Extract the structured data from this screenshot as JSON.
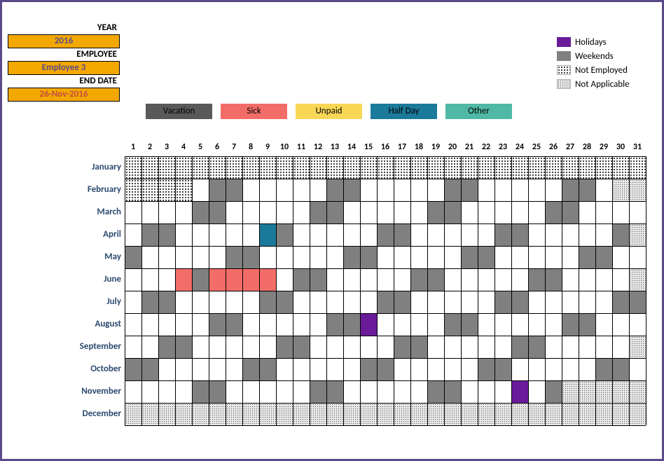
{
  "header": {
    "year_label": "YEAR",
    "year_value": "2016",
    "employee_label": "EMPLOYEE",
    "employee_value": "Employee 3",
    "enddate_label": "END DATE",
    "enddate_value": "26-Nov-2016"
  },
  "legend_right": {
    "holidays": "Holidays",
    "weekends": "Weekends",
    "notemployed": "Not Employed",
    "notapplicable": "Not Applicable"
  },
  "categories": {
    "vacation": "Vacation",
    "sick": "Sick",
    "unpaid": "Unpaid",
    "halfday": "Half Day",
    "other": "Other"
  },
  "days": [
    "1",
    "2",
    "3",
    "4",
    "5",
    "6",
    "7",
    "8",
    "9",
    "10",
    "11",
    "12",
    "13",
    "14",
    "15",
    "16",
    "17",
    "18",
    "19",
    "20",
    "21",
    "22",
    "23",
    "24",
    "25",
    "26",
    "27",
    "28",
    "29",
    "30",
    "31"
  ],
  "months": [
    {
      "name": "January",
      "cells": [
        "notemployed",
        "notemployed",
        "notemployed",
        "notemployed",
        "notemployed",
        "notemployed",
        "notemployed",
        "notemployed",
        "notemployed",
        "notemployed",
        "notemployed",
        "notemployed",
        "notemployed",
        "notemployed",
        "notemployed",
        "notemployed",
        "notemployed",
        "notemployed",
        "notemployed",
        "notemployed",
        "notemployed",
        "notemployed",
        "notemployed",
        "notemployed",
        "notemployed",
        "notemployed",
        "notemployed",
        "notemployed",
        "notemployed",
        "notemployed",
        "notemployed"
      ]
    },
    {
      "name": "February",
      "cells": [
        "notemployed",
        "notemployed",
        "notemployed",
        "notemployed",
        "",
        "weekend",
        "weekend",
        "",
        "",
        "",
        "",
        "",
        "weekend",
        "weekend",
        "",
        "",
        "",
        "",
        "",
        "weekend",
        "weekend",
        "",
        "",
        "",
        "",
        "",
        "weekend",
        "weekend",
        "",
        "notapplicable",
        "notapplicable"
      ]
    },
    {
      "name": "March",
      "cells": [
        "",
        "",
        "",
        "",
        "weekend",
        "weekend",
        "",
        "",
        "",
        "",
        "",
        "weekend",
        "weekend",
        "",
        "",
        "",
        "",
        "",
        "weekend",
        "weekend",
        "",
        "",
        "",
        "",
        "",
        "weekend",
        "weekend",
        "",
        "",
        "",
        "",
        ""
      ]
    },
    {
      "name": "April",
      "cells": [
        "",
        "weekend",
        "weekend",
        "",
        "",
        "",
        "",
        "",
        "halfday",
        "weekend",
        "",
        "",
        "",
        "",
        "",
        "weekend",
        "weekend",
        "",
        "",
        "",
        "",
        "",
        "weekend",
        "weekend",
        "",
        "",
        "",
        "",
        "",
        "weekend",
        "notapplicable"
      ]
    },
    {
      "name": "May",
      "cells": [
        "weekend",
        "",
        "",
        "",
        "",
        "",
        "weekend",
        "weekend",
        "",
        "",
        "",
        "",
        "",
        "weekend",
        "weekend",
        "",
        "",
        "",
        "",
        "",
        "weekend",
        "weekend",
        "",
        "",
        "",
        "",
        "",
        "weekend",
        "weekend",
        "",
        ""
      ]
    },
    {
      "name": "June",
      "cells": [
        "",
        "",
        "",
        "sick",
        "weekend",
        "sick",
        "sick",
        "sick",
        "sick",
        "",
        "weekend",
        "weekend",
        "",
        "",
        "",
        "",
        "",
        "weekend",
        "weekend",
        "",
        "",
        "",
        "",
        "",
        "weekend",
        "weekend",
        "",
        "",
        "",
        "",
        "notapplicable"
      ]
    },
    {
      "name": "July",
      "cells": [
        "",
        "weekend",
        "weekend",
        "",
        "",
        "",
        "",
        "",
        "weekend",
        "weekend",
        "",
        "",
        "",
        "",
        "",
        "weekend",
        "weekend",
        "",
        "",
        "",
        "",
        "",
        "weekend",
        "weekend",
        "",
        "",
        "",
        "",
        "",
        "weekend",
        "weekend"
      ]
    },
    {
      "name": "August",
      "cells": [
        "",
        "",
        "",
        "",
        "",
        "weekend",
        "weekend",
        "",
        "",
        "",
        "",
        "",
        "weekend",
        "weekend",
        "holiday",
        "",
        "",
        "",
        "",
        "weekend",
        "weekend",
        "",
        "",
        "",
        "",
        "",
        "weekend",
        "weekend",
        "",
        "",
        ""
      ]
    },
    {
      "name": "September",
      "cells": [
        "",
        "",
        "weekend",
        "weekend",
        "",
        "",
        "",
        "",
        "",
        "weekend",
        "weekend",
        "",
        "",
        "",
        "",
        "",
        "weekend",
        "weekend",
        "",
        "",
        "",
        "",
        "",
        "weekend",
        "weekend",
        "",
        "",
        "",
        "",
        "",
        "notapplicable"
      ]
    },
    {
      "name": "October",
      "cells": [
        "weekend",
        "weekend",
        "",
        "",
        "",
        "",
        "",
        "weekend",
        "weekend",
        "",
        "",
        "",
        "",
        "",
        "weekend",
        "weekend",
        "",
        "",
        "",
        "",
        "",
        "weekend",
        "weekend",
        "",
        "",
        "",
        "",
        "",
        "weekend",
        "weekend",
        ""
      ]
    },
    {
      "name": "November",
      "cells": [
        "",
        "",
        "",
        "",
        "weekend",
        "weekend",
        "",
        "",
        "",
        "",
        "",
        "weekend",
        "weekend",
        "",
        "",
        "",
        "",
        "",
        "weekend",
        "weekend",
        "",
        "",
        "",
        "holiday",
        "",
        "weekend",
        "notapplicable",
        "notapplicable",
        "notapplicable",
        "notapplicable",
        "notapplicable"
      ]
    },
    {
      "name": "December",
      "cells": [
        "notapplicable",
        "notapplicable",
        "notapplicable",
        "notapplicable",
        "notapplicable",
        "notapplicable",
        "notapplicable",
        "notapplicable",
        "notapplicable",
        "notapplicable",
        "notapplicable",
        "notapplicable",
        "notapplicable",
        "notapplicable",
        "notapplicable",
        "notapplicable",
        "notapplicable",
        "notapplicable",
        "notapplicable",
        "notapplicable",
        "notapplicable",
        "notapplicable",
        "notapplicable",
        "notapplicable",
        "notapplicable",
        "notapplicable",
        "notapplicable",
        "notapplicable",
        "notapplicable",
        "notapplicable",
        "notapplicable"
      ]
    }
  ]
}
